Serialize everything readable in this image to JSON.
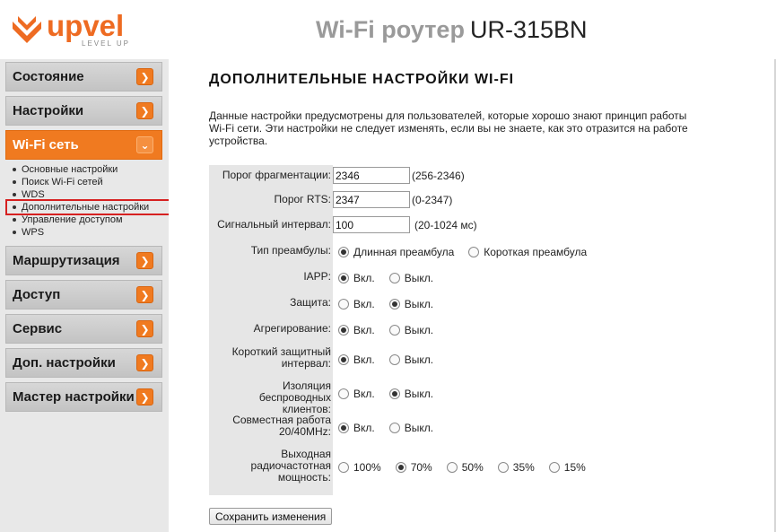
{
  "brand": {
    "name": "upvel",
    "tagline": "LEVEL UP",
    "color": "#ee6b22"
  },
  "header": {
    "title_prefix": "Wi-Fi роутер",
    "model": "UR-315BN"
  },
  "sidebar": {
    "items": [
      {
        "label": "Состояние",
        "icon": "chevron-right-icon"
      },
      {
        "label": "Настройки",
        "icon": "chevron-right-icon"
      },
      {
        "label": "Wi-Fi сеть",
        "icon": "chevron-down-icon",
        "active": true
      },
      {
        "label": "Маршрутизация",
        "icon": "chevron-right-icon"
      },
      {
        "label": "Доступ",
        "icon": "chevron-right-icon"
      },
      {
        "label": "Сервис",
        "icon": "chevron-right-icon"
      },
      {
        "label": "Доп. настройки",
        "icon": "chevron-right-icon"
      },
      {
        "label": "Мастер настройки",
        "icon": "chevron-right-icon"
      }
    ],
    "submenu": [
      "Основные настройки",
      "Поиск Wi-Fi сетей",
      "WDS",
      "Дополнительные настройки",
      "Управление доступом",
      "WPS"
    ],
    "current_submenu": "Дополнительные настройки",
    "highlight_color": "#d62020"
  },
  "main": {
    "title": "ДОПОЛНИТЕЛЬНЫЕ НАСТРОЙКИ WI-FI",
    "description": "Данные настройки предусмотрены для пользователей, которые хорошо знают принцип работы Wi-Fi сети. Эти настройки не следует изменять, если вы не знаете, как это отразится на работе устройства.",
    "fragmentation": {
      "label": "Порог фрагментации:",
      "value": "2346",
      "range": "(256-2346)"
    },
    "rts": {
      "label": "Порог RTS:",
      "value": "2347",
      "range": "(0-2347)"
    },
    "beacon": {
      "label": "Сигнальный интервал:",
      "value": "100",
      "range": "(20-1024 мс)"
    },
    "preamble": {
      "label": "Тип преамбулы:",
      "options": [
        "Длинная преамбула",
        "Короткая преамбула"
      ],
      "selected": 0
    },
    "iapp": {
      "label": "IAPP:",
      "options": [
        "Вкл.",
        "Выкл."
      ],
      "selected": 0
    },
    "protection": {
      "label": "Защита:",
      "options": [
        "Вкл.",
        "Выкл."
      ],
      "selected": 1
    },
    "aggregation": {
      "label": "Агрегирование:",
      "options": [
        "Вкл.",
        "Выкл."
      ],
      "selected": 0
    },
    "short_gi": {
      "label": "Короткий защитный интервал:",
      "options": [
        "Вкл.",
        "Выкл."
      ],
      "selected": 0
    },
    "isolation": {
      "label": "Изоляция беспроводных клиентов:",
      "options": [
        "Вкл.",
        "Выкл."
      ],
      "selected": 1
    },
    "coexist": {
      "label": "Совместная работа 20/40MHz:",
      "options": [
        "Вкл.",
        "Выкл."
      ],
      "selected": 0
    },
    "power": {
      "label": "Выходная радиочастотная мощность:",
      "options": [
        "100%",
        "70%",
        "50%",
        "35%",
        "15%"
      ],
      "selected": 1
    },
    "save_label": "Сохранить изменения"
  }
}
